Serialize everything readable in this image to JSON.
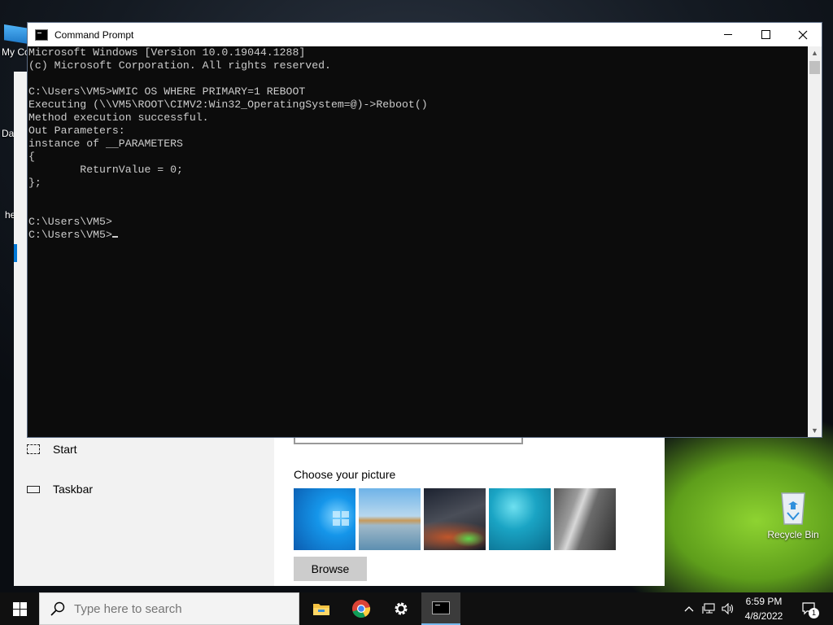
{
  "desktop": {
    "icons": [
      {
        "label": "My Co"
      },
      {
        "label": "Da"
      },
      {
        "label": "he"
      },
      {
        "label": "Recycle Bin"
      }
    ]
  },
  "settings": {
    "nav": [
      {
        "label": "Start",
        "icon": "start-layout-icon"
      },
      {
        "label": "Taskbar",
        "icon": "taskbar-layout-icon"
      }
    ],
    "choose_label": "Choose your picture",
    "browse_label": "Browse"
  },
  "cmd": {
    "title": "Command Prompt",
    "lines": [
      "Microsoft Windows [Version 10.0.19044.1288]",
      "(c) Microsoft Corporation. All rights reserved.",
      "",
      "C:\\Users\\VM5>WMIC OS WHERE PRIMARY=1 REBOOT",
      "Executing (\\\\VM5\\ROOT\\CIMV2:Win32_OperatingSystem=@)->Reboot()",
      "Method execution successful.",
      "Out Parameters:",
      "instance of __PARAMETERS",
      "{",
      "        ReturnValue = 0;",
      "};",
      "",
      "",
      "C:\\Users\\VM5>"
    ],
    "prompt": "C:\\Users\\VM5>"
  },
  "taskbar": {
    "search_placeholder": "Type here to search",
    "apps": [
      "file-explorer-icon",
      "chrome-icon",
      "settings-gear-icon",
      "command-prompt-icon"
    ],
    "time": "6:59 PM",
    "date": "4/8/2022",
    "notification_count": "1"
  }
}
